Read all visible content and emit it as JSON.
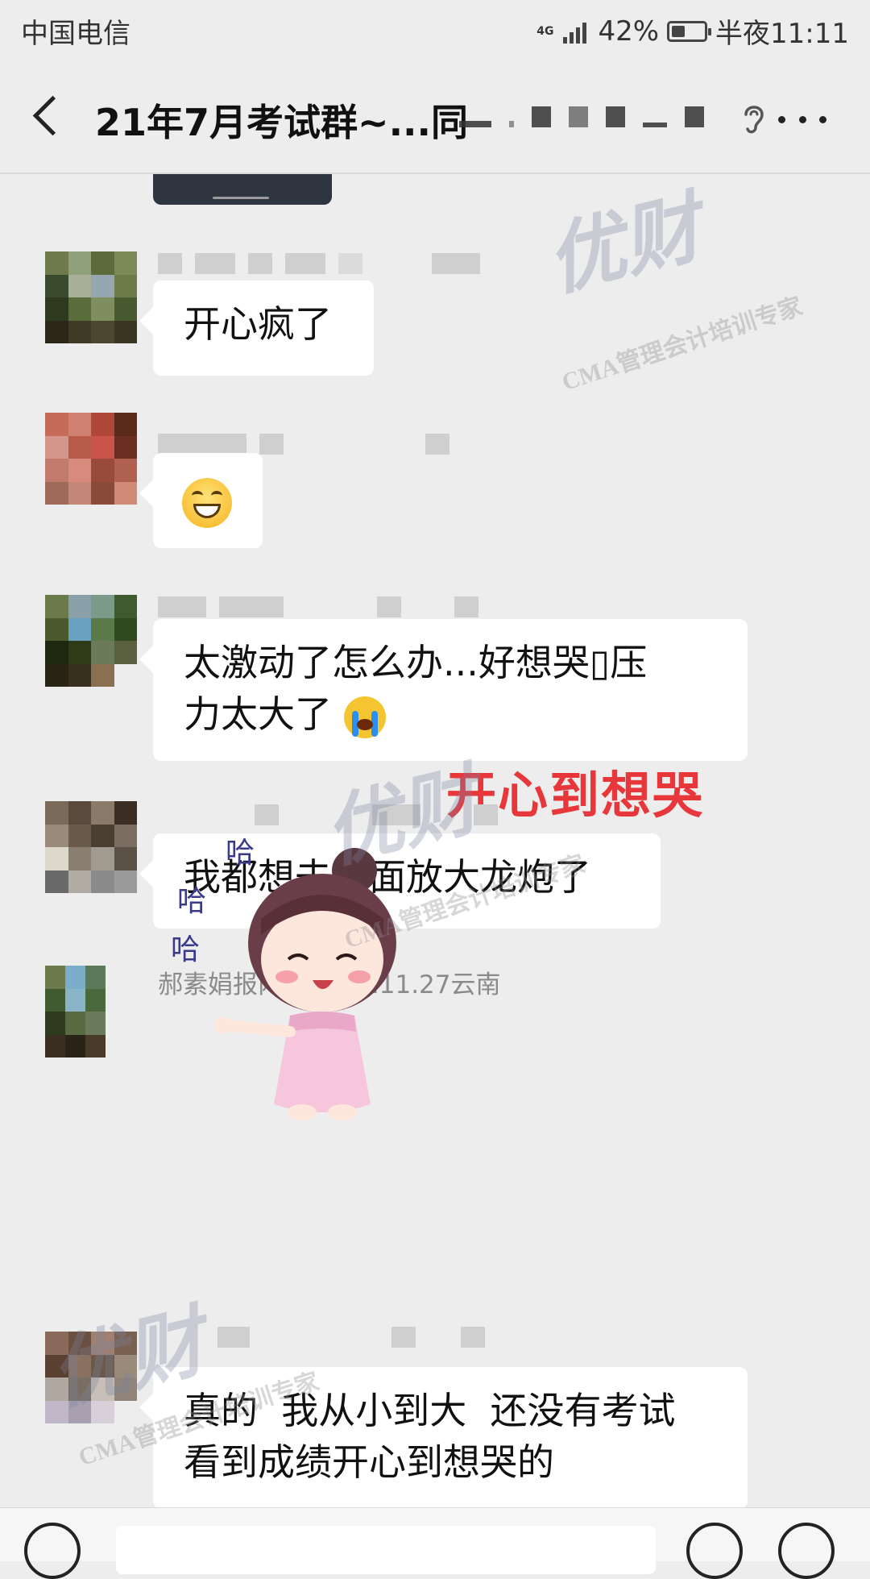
{
  "status_bar": {
    "carrier": "中国电信",
    "network": "4G",
    "battery_percent": "42%",
    "battery_level": 0.42,
    "time": "半夜11:11"
  },
  "header": {
    "title": "21年7月考试群~...同"
  },
  "messages": [
    {
      "text_line1": "开心疯了"
    },
    {
      "emoji": "grinning-face-emoji"
    },
    {
      "text_line1": "太激动了怎么办...好想哭",
      "text_line1b": "压",
      "text_line2": "力太大了"
    },
    {
      "text_line1": "我都想去外面放大龙炮了"
    },
    {
      "sender": "郝素娟报两科2020.11.27云南",
      "sticker": [
        "哈",
        "哈",
        "哈"
      ]
    },
    {
      "text_line1": "真的  我从小到大  还没有考试",
      "text_line2": "看到成绩开心到想哭的"
    }
  ],
  "overlay_caption": "开心到想哭",
  "watermark": {
    "logo": "优财",
    "sub": "CMA管理会计培训专家"
  }
}
